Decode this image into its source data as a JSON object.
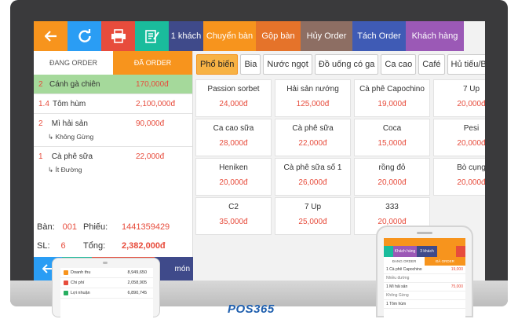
{
  "toolbar": {
    "buttons": [
      {
        "label": "1 khách",
        "color": "#3f4a8a"
      },
      {
        "label": "Chuyển bàn",
        "color": "#f7941d"
      },
      {
        "label": "Gộp bàn",
        "color": "#e5732a"
      },
      {
        "label": "Hủy Order",
        "color": "#8d6e63"
      },
      {
        "label": "Tách Order",
        "color": "#3f5bb5"
      },
      {
        "label": "Khách hàng",
        "color": "#9b59b6"
      }
    ]
  },
  "order_panel": {
    "tabs": [
      "ĐANG ORDER",
      "ĐÃ ORDER"
    ],
    "items": [
      {
        "idx": "2",
        "name": "Cánh gà chiên",
        "price": "170,000đ",
        "note": ""
      },
      {
        "idx": "1.4",
        "name": "Tôm hùm",
        "price": "2,100,000đ",
        "note": ""
      },
      {
        "idx": "2",
        "name": "Mì hải sản",
        "price": "90,000đ",
        "note": "Không Gừng"
      },
      {
        "idx": "1",
        "name": "Cà phê sữa",
        "price": "22,000đ",
        "note": "Ít Đường"
      }
    ],
    "summary": {
      "table_label": "Bàn:",
      "table_value": "001",
      "bill_label": "Phiếu:",
      "bill_value": "1441359429",
      "qty_label": "SL:",
      "qty_value": "6",
      "total_label": "Tổng:",
      "total_value": "2,382,000đ"
    },
    "bottom_text": "món"
  },
  "categories": [
    "Phổ biến",
    "Bia",
    "Nước ngọt",
    "Đồ uống có ga",
    "Ca cao",
    "Café",
    "Hủ tiếu/Bún"
  ],
  "products": [
    {
      "name": "Passion sorbet",
      "price": "24,000đ"
    },
    {
      "name": "Hải sản nướng",
      "price": "125,000đ"
    },
    {
      "name": "Cà phê Capochino",
      "price": "19,000đ"
    },
    {
      "name": "7 Up",
      "price": "20,000đ"
    },
    {
      "name": "Ca cao sữa",
      "price": "28,000đ"
    },
    {
      "name": "Cà phê sữa",
      "price": "22,000đ"
    },
    {
      "name": "Coca",
      "price": "15,000đ"
    },
    {
      "name": "Pesi",
      "price": "20,000đ"
    },
    {
      "name": "Heniken",
      "price": "20,000đ"
    },
    {
      "name": "Cà phê sữa số 1",
      "price": "26,000đ"
    },
    {
      "name": "rồng đỏ",
      "price": "20,000đ"
    },
    {
      "name": "Bò cụng",
      "price": "20,000đ"
    },
    {
      "name": "C2",
      "price": "35,000đ"
    },
    {
      "name": "7 Up",
      "price": "25,000đ"
    },
    {
      "name": "333",
      "price": "20,000đ"
    }
  ],
  "tablet": {
    "rows": [
      {
        "label": "Doanh thu",
        "value": "8,949,650",
        "color": "#f7941d"
      },
      {
        "label": "Chi phí",
        "value": "2,058,905",
        "color": "#e74c3c"
      },
      {
        "label": "Lợi nhuận",
        "value": "6,890,745",
        "color": "#27ae60"
      }
    ]
  },
  "phone": {
    "top_buttons": [
      "Khách hàng",
      "3 khách"
    ],
    "tabs": [
      "ĐANG ORDER",
      "ĐÃ ORDER"
    ],
    "rows": [
      {
        "text": "1 Cà phê Capochino",
        "price": "19,000"
      },
      {
        "text": "Nhiều đường",
        "price": ""
      },
      {
        "text": "1 Mì hải sản",
        "price": "75,000"
      },
      {
        "text": "Không Gừng",
        "price": ""
      },
      {
        "text": "1 Tôm hùm",
        "price": ""
      }
    ]
  },
  "brand": {
    "logo": "POS365"
  }
}
